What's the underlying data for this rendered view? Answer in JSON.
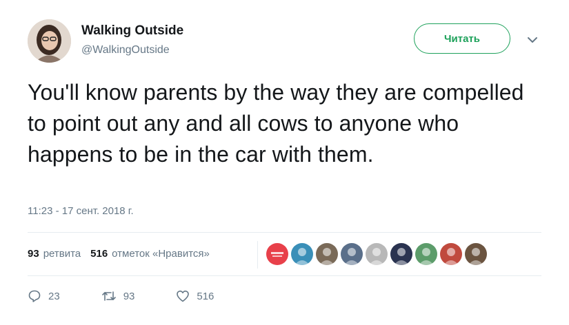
{
  "user": {
    "name": "Walking Outside",
    "handle": "@WalkingOutside"
  },
  "follow_button": {
    "label": "Читать"
  },
  "tweet": {
    "text": "You'll know parents by the way they are compelled to point out any and all cows to anyone who happens to be in the car with them.",
    "timestamp": "11:23 - 17 сент. 2018 г."
  },
  "stats": {
    "retweets_count": "93",
    "retweets_label": "ретвита",
    "likes_count": "516",
    "likes_label": "отметок «Нравится»"
  },
  "likers": [
    {
      "icon": "badge-avatar",
      "color": "#e8404a"
    },
    {
      "icon": "user-avatar",
      "color": "#3a8fb8"
    },
    {
      "icon": "user-avatar",
      "color": "#7a6a58"
    },
    {
      "icon": "user-avatar",
      "color": "#5a6f8a"
    },
    {
      "icon": "user-avatar",
      "color": "#b8b8b8"
    },
    {
      "icon": "user-avatar",
      "color": "#2a3350"
    },
    {
      "icon": "user-avatar",
      "color": "#5c9c6a"
    },
    {
      "icon": "user-avatar",
      "color": "#c04a3e"
    },
    {
      "icon": "user-avatar",
      "color": "#6b5440"
    }
  ],
  "actions": {
    "reply_count": "23",
    "retweet_count": "93",
    "like_count": "516"
  },
  "colors": {
    "accent_green": "#1da15a",
    "secondary_text": "#657786"
  }
}
